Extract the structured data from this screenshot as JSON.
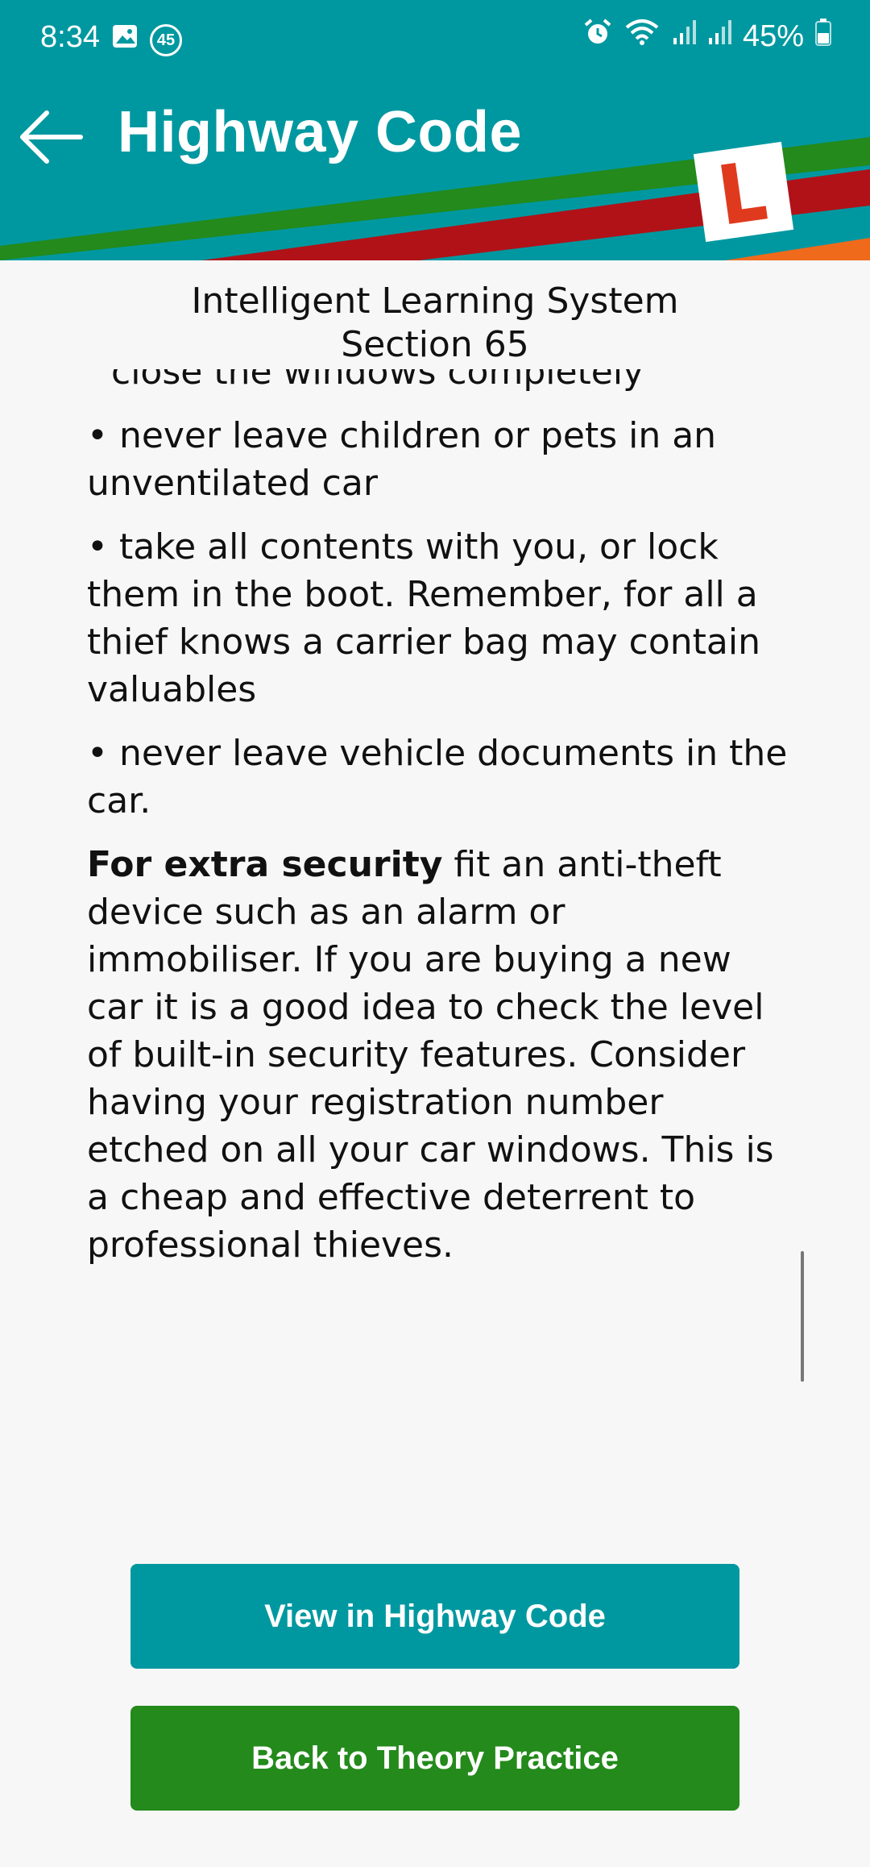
{
  "status_bar": {
    "time": "8:34",
    "notification_count": "45",
    "battery": "45%",
    "icons": [
      "image-icon",
      "badge-45-icon",
      "alarm-icon",
      "wifi-icon",
      "signal-icon",
      "signal-icon",
      "battery-icon"
    ]
  },
  "app_bar": {
    "title": "Highway Code",
    "back_icon": "arrow-left-icon",
    "logo_letter": "L"
  },
  "header": {
    "line1": "Intelligent Learning System",
    "line2": "Section 65"
  },
  "content": {
    "partial_line": "close the windows completely",
    "bullets": [
      "• never leave children or pets in an unventilated car",
      "• take all contents with you, or lock them in the boot. Remember, for all a thief knows a carrier bag may contain valuables",
      "• never leave vehicle documents in the car."
    ],
    "security_bold": "For extra security",
    "security_text": " fit an anti-theft device such as an alarm or immobiliser. If you are buying a new car it is a good idea to check the level of built-in security features. Consider having your registration number etched on all your car windows. This is a cheap and effective deterrent to professional thieves."
  },
  "buttons": {
    "view": "View in Highway Code",
    "back": "Back to Theory Practice"
  },
  "colors": {
    "teal": "#0098a0",
    "green": "#238a1b",
    "red": "#b01218",
    "orange": "#f06a1c"
  }
}
